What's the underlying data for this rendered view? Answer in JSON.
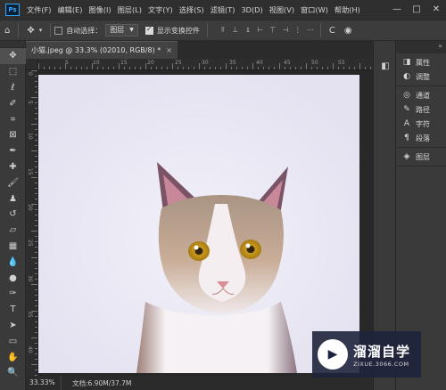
{
  "app": {
    "logo_text": "Ps"
  },
  "menu": [
    "文件(F)",
    "编辑(E)",
    "图像(I)",
    "图层(L)",
    "文字(Y)",
    "选择(S)",
    "滤镜(T)",
    "3D(D)",
    "视图(V)",
    "窗口(W)",
    "帮助(H)"
  ],
  "window_controls": {
    "minimize": "—",
    "maximize": "□",
    "close": "✕"
  },
  "options_bar": {
    "auto_select_label": "自动选择：",
    "auto_select_checked": false,
    "auto_select_target": "图层",
    "show_transform_label": "显示变换控件",
    "show_transform_checked": true
  },
  "document_tab": {
    "title": "小猫.jpeg @ 33.3% (02010, RGB/8) *",
    "close": "×"
  },
  "rulers": {
    "horizontal": [
      "",
      "5",
      "10",
      "15",
      "20",
      "25",
      "30",
      "35",
      "40",
      "45",
      "50",
      "55"
    ],
    "vertical": [
      "0",
      "5",
      "10",
      "15",
      "20",
      "25",
      "30",
      "35",
      "40"
    ]
  },
  "status": {
    "zoom": "33.33%",
    "doc_info": "文档:6.90M/37.7M"
  },
  "panels": [
    {
      "icon": "properties-icon",
      "glyph": "◨",
      "label": "属性"
    },
    {
      "icon": "adjustments-icon",
      "glyph": "◐",
      "label": "调整"
    },
    {
      "icon": "channels-icon",
      "glyph": "◎",
      "label": "通道"
    },
    {
      "icon": "paths-icon",
      "glyph": "✎",
      "label": "路径"
    },
    {
      "icon": "character-icon",
      "glyph": "A",
      "label": "字符"
    },
    {
      "icon": "paragraph-icon",
      "glyph": "¶",
      "label": "段落"
    },
    {
      "icon": "layers-icon",
      "glyph": "◈",
      "label": "图层"
    }
  ],
  "watermark": {
    "title": "溜溜自学",
    "url": "ZIXUE.3066.COM"
  },
  "colors": {
    "accent": "#31a8ff",
    "menubar_bg": "#2f2f2f",
    "panel_bg": "#3a3a3a"
  }
}
